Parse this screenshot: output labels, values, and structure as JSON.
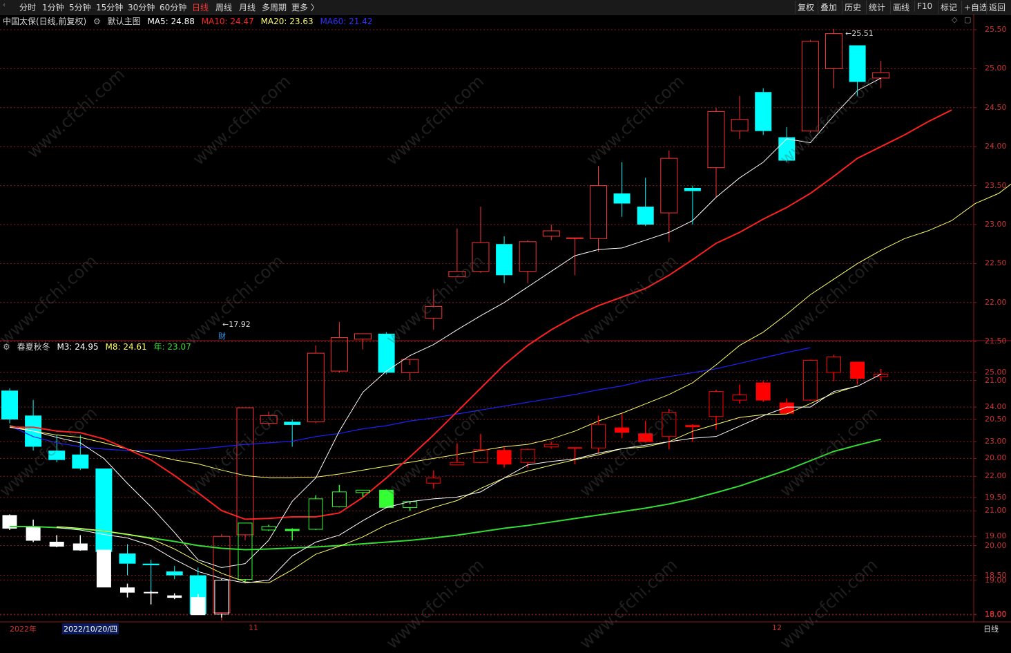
{
  "toolbar": {
    "left_items": [
      "分时",
      "1分钟",
      "5分钟",
      "15分钟",
      "30分钟",
      "60分钟",
      "日线",
      "周线",
      "月线",
      "多周期",
      "更多 〉"
    ],
    "active_item": "日线",
    "right_items": [
      "复权",
      "叠加",
      "历史",
      "统计",
      "画线",
      "F10",
      "标记",
      "+自选",
      "返回"
    ]
  },
  "main_legend": {
    "stock_label": "中国太保(日线,前复权)",
    "indicator_name": "默认主图",
    "ma5": "MA5: 24.88",
    "ma10": "MA10: 24.47",
    "ma20": "MA20: 23.63",
    "ma60": "MA60: 21.42"
  },
  "sub_legend": {
    "indicator_name": "春夏秋冬",
    "m3": "M3: 24.95",
    "m8": "M8: 24.61",
    "year": "年: 23.07"
  },
  "colors": {
    "up": "#ff3232",
    "down_main": "#00ffff",
    "down_sub": "#ffffff",
    "up_sub": "#ff0000",
    "green_sub": "#33ff33",
    "ma5": "#ffffff",
    "ma10": "#ff2020",
    "ma20": "#ffff66",
    "ma60": "#2020ff",
    "year": "#33dd33",
    "grid": "#8b1a1a"
  },
  "annotations": {
    "high_label": "25.51",
    "low_label": "17.92",
    "finance_marker": "财"
  },
  "date_axis": {
    "year": "2022年",
    "cursor_date": "2022/10/20/四",
    "nov": "11",
    "dec": "12",
    "period": "日线"
  },
  "watermark": "www.cfchi.com",
  "main_axis": [
    "25.50",
    "25.00",
    "24.50",
    "24.00",
    "23.50",
    "23.00",
    "22.50",
    "22.00",
    "21.50",
    "21.00",
    "20.50",
    "20.00",
    "19.50",
    "19.00",
    "18.50",
    "18.00"
  ],
  "sub_axis": [
    "25.00",
    "24.00",
    "23.00",
    "22.00",
    "21.00",
    "20.00",
    "19.00",
    "18.00"
  ],
  "chart_data": {
    "type": "candlestick",
    "candles": [
      {
        "o": 20.87,
        "h": 20.9,
        "c": 20.5,
        "l": 20.45
      },
      {
        "o": 20.55,
        "h": 20.75,
        "c": 20.15,
        "l": 20.1
      },
      {
        "o": 20.1,
        "h": 20.3,
        "c": 19.98,
        "l": 19.95
      },
      {
        "o": 20.05,
        "h": 20.3,
        "c": 19.87,
        "l": 19.85
      },
      {
        "o": 19.87,
        "h": 19.87,
        "c": 18.8,
        "l": 18.8
      },
      {
        "o": 18.78,
        "h": 18.9,
        "c": 18.65,
        "l": 18.5
      },
      {
        "o": 18.65,
        "h": 18.7,
        "c": 18.63,
        "l": 18.3
      },
      {
        "o": 18.55,
        "h": 18.62,
        "c": 18.5,
        "l": 18.45
      },
      {
        "o": 18.5,
        "h": 18.6,
        "c": 18.0,
        "l": 18.0
      },
      {
        "o": 18.02,
        "h": 19.03,
        "c": 19.0,
        "l": 17.92
      },
      {
        "o": 19.02,
        "h": 20.65,
        "c": 20.65,
        "l": 18.95
      },
      {
        "o": 20.45,
        "h": 20.6,
        "c": 20.55,
        "l": 20.42
      },
      {
        "o": 20.47,
        "h": 20.5,
        "c": 20.43,
        "l": 20.15
      },
      {
        "o": 20.47,
        "h": 21.45,
        "c": 21.35,
        "l": 20.45
      },
      {
        "o": 21.12,
        "h": 21.75,
        "c": 21.55,
        "l": 21.1
      },
      {
        "o": 21.53,
        "h": 21.6,
        "c": 21.6,
        "l": 21.4
      },
      {
        "o": 21.6,
        "h": 21.62,
        "c": 21.1,
        "l": 21.08
      },
      {
        "o": 21.1,
        "h": 21.2,
        "c": 21.27,
        "l": 21.0
      },
      {
        "o": 21.8,
        "h": 22.17,
        "c": 21.95,
        "l": 21.65
      },
      {
        "o": 22.33,
        "h": 22.95,
        "c": 22.4,
        "l": 22.33
      },
      {
        "o": 22.4,
        "h": 23.23,
        "c": 22.77,
        "l": 22.38
      },
      {
        "o": 22.75,
        "h": 22.85,
        "c": 22.35,
        "l": 22.25
      },
      {
        "o": 22.4,
        "h": 22.8,
        "c": 22.78,
        "l": 22.25
      },
      {
        "o": 22.85,
        "h": 23.0,
        "c": 22.92,
        "l": 22.8
      },
      {
        "o": 22.83,
        "h": 22.83,
        "c": 22.83,
        "l": 22.35
      },
      {
        "o": 22.82,
        "h": 23.75,
        "c": 23.5,
        "l": 22.65
      },
      {
        "o": 23.4,
        "h": 23.8,
        "c": 23.27,
        "l": 23.1
      },
      {
        "o": 23.23,
        "h": 23.6,
        "c": 23.0,
        "l": 22.98
      },
      {
        "o": 23.15,
        "h": 23.95,
        "c": 23.85,
        "l": 22.78
      },
      {
        "o": 23.47,
        "h": 23.5,
        "c": 23.43,
        "l": 23.0
      },
      {
        "o": 23.73,
        "h": 24.5,
        "c": 24.45,
        "l": 23.35
      },
      {
        "o": 24.2,
        "h": 24.65,
        "c": 24.35,
        "l": 24.1
      },
      {
        "o": 24.7,
        "h": 24.75,
        "c": 24.2,
        "l": 24.15
      },
      {
        "o": 24.12,
        "h": 24.25,
        "c": 23.82,
        "l": 23.8
      },
      {
        "o": 24.2,
        "h": 25.37,
        "c": 25.35,
        "l": 24.18
      },
      {
        "o": 25.0,
        "h": 25.51,
        "c": 25.45,
        "l": 24.75
      },
      {
        "o": 25.3,
        "h": 25.3,
        "c": 24.83,
        "l": 24.65
      },
      {
        "o": 24.88,
        "h": 25.1,
        "c": 24.95,
        "l": 24.75
      }
    ],
    "ma5": [
      20.4,
      20.35,
      20.27,
      20.2,
      20.0,
      19.68,
      19.38,
      19.05,
      18.7,
      18.6,
      18.65,
      18.95,
      19.45,
      19.75,
      20.35,
      20.85,
      21.12,
      21.32,
      21.46,
      21.65,
      21.83,
      22.0,
      22.2,
      22.4,
      22.6,
      22.68,
      22.7,
      22.8,
      22.9,
      23.05,
      23.35,
      23.6,
      23.8,
      24.1,
      24.05,
      24.4,
      24.72,
      24.88
    ],
    "ma10": [
      20.4,
      20.4,
      20.35,
      20.33,
      20.25,
      20.12,
      19.98,
      19.78,
      19.56,
      19.33,
      19.22,
      19.23,
      19.25,
      19.25,
      19.3,
      19.5,
      19.75,
      20.02,
      20.3,
      20.6,
      20.9,
      21.2,
      21.45,
      21.65,
      21.82,
      21.96,
      22.07,
      22.18,
      22.35,
      22.55,
      22.76,
      22.9,
      23.07,
      23.22,
      23.4,
      23.62,
      23.85,
      24.0,
      24.15,
      24.32,
      24.47
    ],
    "ma20": [
      20.42,
      20.35,
      20.3,
      20.27,
      20.2,
      20.12,
      20.05,
      19.98,
      19.93,
      19.85,
      19.78,
      19.75,
      19.75,
      19.76,
      19.8,
      19.85,
      19.9,
      19.95,
      20.0,
      20.05,
      20.1,
      20.15,
      20.18,
      20.25,
      20.35,
      20.48,
      20.58,
      20.7,
      20.82,
      20.97,
      21.2,
      21.45,
      21.62,
      21.85,
      22.1,
      22.3,
      22.5,
      22.67,
      22.82,
      22.92,
      23.05,
      23.27,
      23.4,
      23.63
    ],
    "ma60": [
      20.42,
      20.28,
      20.2,
      20.15,
      20.12,
      20.1,
      20.1,
      20.1,
      20.12,
      20.15,
      20.18,
      20.2,
      20.22,
      20.28,
      20.32,
      20.38,
      20.42,
      20.48,
      20.52,
      20.57,
      20.62,
      20.67,
      20.72,
      20.77,
      20.82,
      20.88,
      20.93,
      21.0,
      21.05,
      21.1,
      21.15,
      21.22,
      21.29,
      21.36,
      21.42
    ],
    "sub_m3": [
      20.52,
      20.45,
      20.32,
      20.22,
      20.0,
      19.6,
      19.25,
      19.05,
      18.92,
      19.0,
      19.7,
      20.1,
      20.3,
      20.72,
      21.1,
      21.27,
      21.35,
      21.4,
      21.55,
      21.95,
      22.33,
      22.43,
      22.5,
      22.67,
      22.8,
      22.9,
      23.0,
      23.1,
      23.15,
      23.45,
      23.75,
      24.0,
      24.0,
      24.45,
      24.6,
      24.95
    ],
    "sub_m8": [
      20.55,
      20.5,
      20.42,
      20.33,
      20.2,
      19.9,
      19.53,
      19.2,
      18.95,
      18.92,
      19.3,
      19.75,
      19.98,
      20.25,
      20.6,
      20.85,
      21.1,
      21.3,
      21.65,
      21.95,
      22.15,
      22.32,
      22.48,
      22.62,
      22.8,
      22.85,
      23.0,
      23.3,
      23.5,
      23.7,
      23.78,
      23.8,
      24.1,
      24.4,
      24.61
    ],
    "sub_year": [
      20.55,
      20.55,
      20.52,
      20.48,
      20.42,
      20.32,
      20.22,
      20.12,
      20.0,
      19.92,
      19.88,
      19.9,
      19.93,
      19.96,
      20.0,
      20.05,
      20.1,
      20.15,
      20.22,
      20.3,
      20.4,
      20.5,
      20.58,
      20.68,
      20.78,
      20.88,
      20.98,
      21.08,
      21.2,
      21.35,
      21.53,
      21.72,
      21.95,
      22.18,
      22.45,
      22.72,
      22.9,
      23.07
    ]
  }
}
